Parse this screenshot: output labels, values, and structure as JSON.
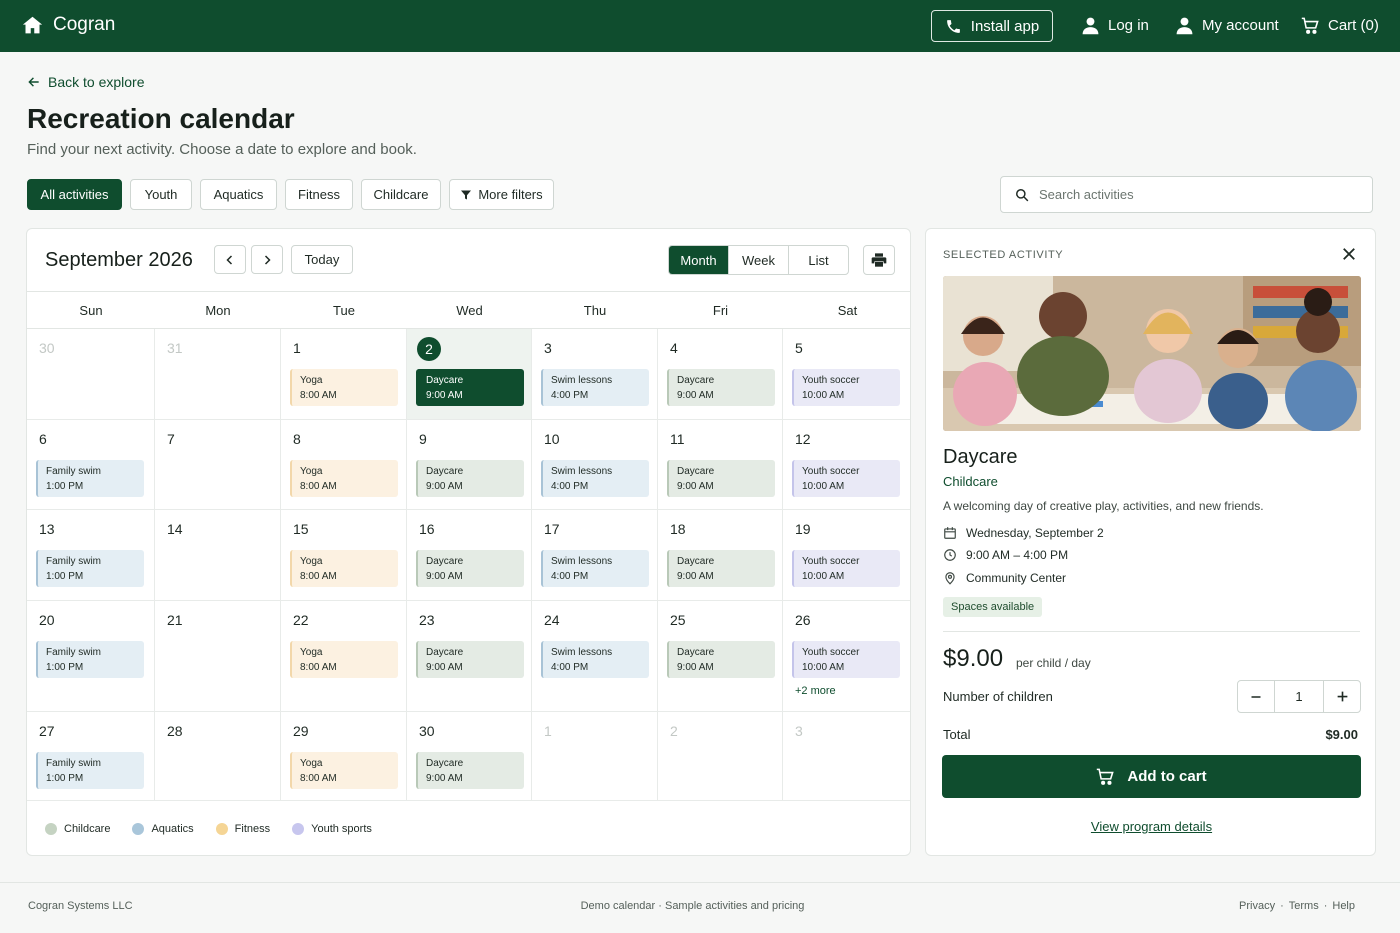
{
  "app": {
    "brand": "Cogran",
    "install_label": "Install app",
    "login_label": "Log in",
    "account_label": "My account",
    "cart_label": "Cart (0)"
  },
  "header": {
    "back_label": "Back to explore",
    "title": "Recreation calendar",
    "subtitle": "Find your next activity. Choose a date to explore and book."
  },
  "filters": {
    "chips": [
      "All activities",
      "Youth",
      "Aquatics",
      "Fitness",
      "Childcare",
      "More filters"
    ],
    "active_index": 0,
    "search_placeholder": "Search activities"
  },
  "calendar": {
    "month_label": "September 2026",
    "today_label": "Today",
    "views": [
      "Month",
      "Week",
      "List"
    ],
    "active_view": 0,
    "weekdays": [
      "Sun",
      "Mon",
      "Tue",
      "Wed",
      "Thu",
      "Fri",
      "Sat"
    ],
    "weeks": [
      [
        {
          "day": "30",
          "muted": true,
          "events": []
        },
        {
          "day": "31",
          "muted": true,
          "events": []
        },
        {
          "day": "1",
          "events": [
            {
              "name": "Yoga",
              "time": "8:00 AM",
              "cat": "fitness"
            }
          ]
        },
        {
          "day": "2",
          "selected": true,
          "events": [
            {
              "name": "Daycare",
              "time": "9:00 AM",
              "cat": "childcare",
              "active": true
            }
          ]
        },
        {
          "day": "3",
          "events": [
            {
              "name": "Swim lessons",
              "time": "4:00 PM",
              "cat": "aquatics"
            }
          ]
        },
        {
          "day": "4",
          "events": [
            {
              "name": "Daycare",
              "time": "9:00 AM",
              "cat": "childcare"
            }
          ]
        },
        {
          "day": "5",
          "events": [
            {
              "name": "Youth soccer",
              "time": "10:00 AM",
              "cat": "youth"
            }
          ]
        }
      ],
      [
        {
          "day": "6",
          "events": [
            {
              "name": "Family swim",
              "time": "1:00 PM",
              "cat": "aquatics"
            }
          ]
        },
        {
          "day": "7",
          "events": []
        },
        {
          "day": "8",
          "events": [
            {
              "name": "Yoga",
              "time": "8:00 AM",
              "cat": "fitness"
            }
          ]
        },
        {
          "day": "9",
          "events": [
            {
              "name": "Daycare",
              "time": "9:00 AM",
              "cat": "childcare"
            }
          ]
        },
        {
          "day": "10",
          "events": [
            {
              "name": "Swim lessons",
              "time": "4:00 PM",
              "cat": "aquatics"
            }
          ]
        },
        {
          "day": "11",
          "events": [
            {
              "name": "Daycare",
              "time": "9:00 AM",
              "cat": "childcare"
            }
          ]
        },
        {
          "day": "12",
          "events": [
            {
              "name": "Youth soccer",
              "time": "10:00 AM",
              "cat": "youth"
            }
          ]
        }
      ],
      [
        {
          "day": "13",
          "events": [
            {
              "name": "Family swim",
              "time": "1:00 PM",
              "cat": "aquatics"
            }
          ]
        },
        {
          "day": "14",
          "events": []
        },
        {
          "day": "15",
          "events": [
            {
              "name": "Yoga",
              "time": "8:00 AM",
              "cat": "fitness"
            }
          ]
        },
        {
          "day": "16",
          "events": [
            {
              "name": "Daycare",
              "time": "9:00 AM",
              "cat": "childcare"
            }
          ]
        },
        {
          "day": "17",
          "events": [
            {
              "name": "Swim lessons",
              "time": "4:00 PM",
              "cat": "aquatics"
            }
          ]
        },
        {
          "day": "18",
          "events": [
            {
              "name": "Daycare",
              "time": "9:00 AM",
              "cat": "childcare"
            }
          ]
        },
        {
          "day": "19",
          "events": [
            {
              "name": "Youth soccer",
              "time": "10:00 AM",
              "cat": "youth"
            }
          ]
        }
      ],
      [
        {
          "day": "20",
          "events": [
            {
              "name": "Family swim",
              "time": "1:00 PM",
              "cat": "aquatics"
            }
          ]
        },
        {
          "day": "21",
          "events": []
        },
        {
          "day": "22",
          "events": [
            {
              "name": "Yoga",
              "time": "8:00 AM",
              "cat": "fitness"
            }
          ]
        },
        {
          "day": "23",
          "events": [
            {
              "name": "Daycare",
              "time": "9:00 AM",
              "cat": "childcare"
            }
          ]
        },
        {
          "day": "24",
          "events": [
            {
              "name": "Swim lessons",
              "time": "4:00 PM",
              "cat": "aquatics"
            }
          ]
        },
        {
          "day": "25",
          "events": [
            {
              "name": "Daycare",
              "time": "9:00 AM",
              "cat": "childcare"
            }
          ]
        },
        {
          "day": "26",
          "events": [
            {
              "name": "Youth soccer",
              "time": "10:00 AM",
              "cat": "youth"
            }
          ],
          "more": "+2 more"
        }
      ],
      [
        {
          "day": "27",
          "events": [
            {
              "name": "Family swim",
              "time": "1:00 PM",
              "cat": "aquatics"
            }
          ]
        },
        {
          "day": "28",
          "events": []
        },
        {
          "day": "29",
          "events": [
            {
              "name": "Yoga",
              "time": "8:00 AM",
              "cat": "fitness"
            }
          ]
        },
        {
          "day": "30",
          "events": [
            {
              "name": "Daycare",
              "time": "9:00 AM",
              "cat": "childcare"
            }
          ]
        },
        {
          "day": "1",
          "muted": true,
          "events": []
        },
        {
          "day": "2",
          "muted": true,
          "events": []
        },
        {
          "day": "3",
          "muted": true,
          "events": []
        }
      ]
    ],
    "legend": [
      {
        "label": "Childcare",
        "color": "#c5d3c2"
      },
      {
        "label": "Aquatics",
        "color": "#a9c6da"
      },
      {
        "label": "Fitness",
        "color": "#f5d595"
      },
      {
        "label": "Youth sports",
        "color": "#c7c6ee"
      }
    ]
  },
  "detail": {
    "section_label": "SELECTED ACTIVITY",
    "name": "Daycare",
    "category": "Childcare",
    "description": "A welcoming day of creative play, activities, and new friends.",
    "date": "Wednesday, September 2",
    "time": "9:00 AM – 4:00 PM",
    "location": "Community Center",
    "availability": "Spaces available",
    "price": "$9.00",
    "price_unit": "per child / day",
    "quantity_label": "Number of children",
    "quantity": "1",
    "total_label": "Total",
    "total_value": "$9.00",
    "add_to_cart_label": "Add to cart",
    "details_link": "View program details"
  },
  "footer": {
    "company": "Cogran Systems LLC",
    "center": "Demo calendar · Sample activities and pricing",
    "links": [
      "Privacy",
      "Terms",
      "Help"
    ]
  },
  "colors": {
    "brand": "#0f4d2e",
    "childcare": "#c5d3c2",
    "aquatics": "#a9c6da",
    "fitness": "#f5d595",
    "youth": "#c7c6ee"
  }
}
